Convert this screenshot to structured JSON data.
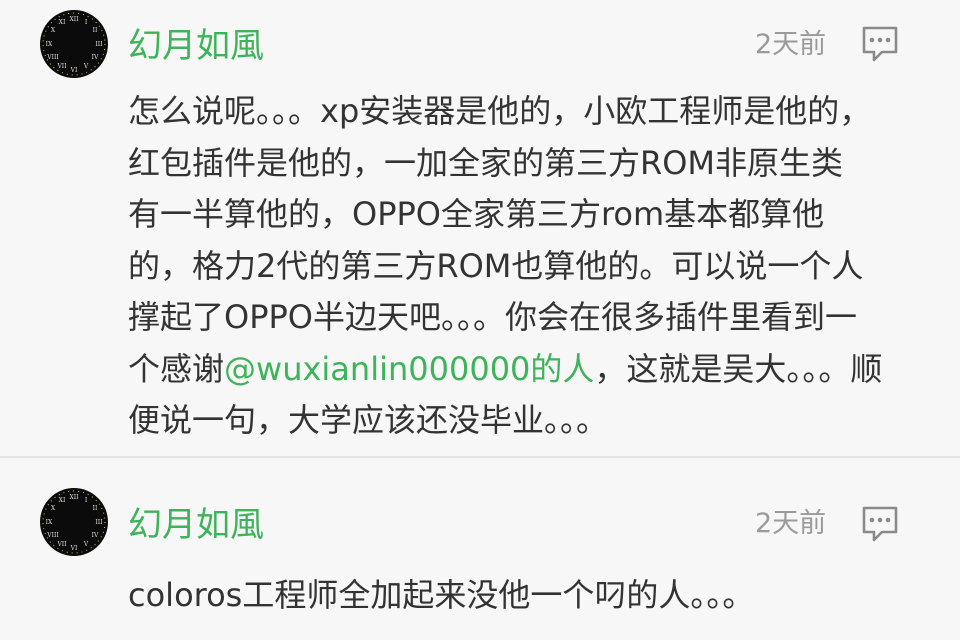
{
  "comments": [
    {
      "username": "幻月如風",
      "time": "2天前",
      "lines": [
        "怎么说呢。。。xp安装器是他的，小欧工程师是他的，",
        "红包插件是他的，一加全家的第三方ROM非原生类",
        "有一半算他的，OPPO全家第三方rom基本都算他",
        "的，格力2代的第三方ROM也算他的。可以说一个人",
        "撑起了OPPO半边天吧。。。你会在很多插件里看到一"
      ],
      "mention_line": {
        "before": "个感谢",
        "mention": "@wuxianlin000000的人",
        "after": "，这就是吴大。。。顺"
      },
      "last_line": "便说一句，大学应该还没毕业。。。"
    },
    {
      "username": "幻月如風",
      "time": "2天前",
      "lines": [
        "coloros工程师全加起来没他一个叼的人。。。"
      ]
    }
  ],
  "icons": {
    "avatar": "clock-face-avatar",
    "reply": "comment-reply-icon"
  },
  "colors": {
    "username": "#3db35a",
    "mention": "#3db35a",
    "time": "#9a9a9a",
    "body": "#333333",
    "background": "#f7f7f7"
  }
}
